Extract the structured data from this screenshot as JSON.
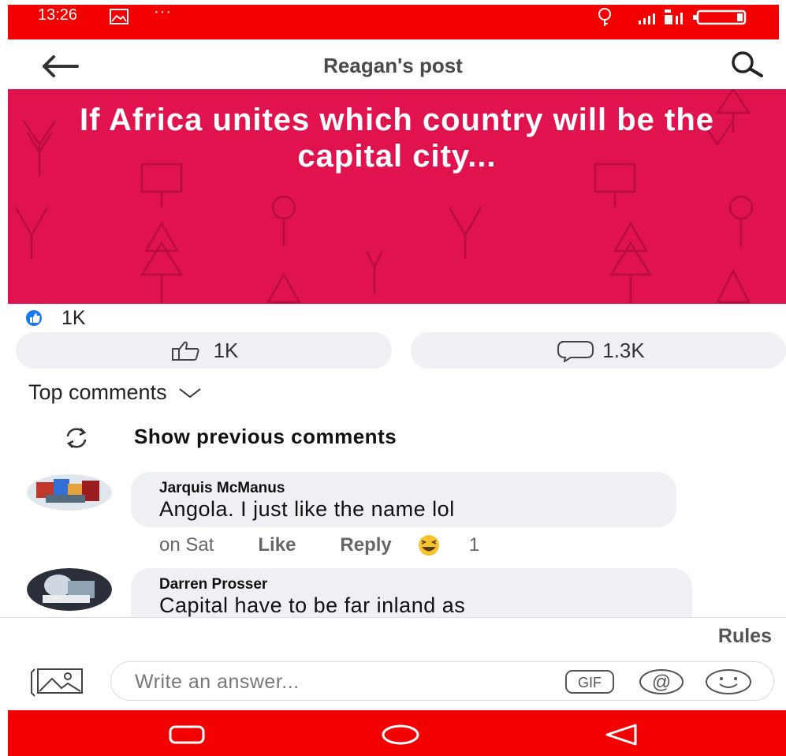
{
  "status_bar": {
    "time": "13:26",
    "dots": "···",
    "color": "#f30000"
  },
  "header": {
    "title": "Reagan's post"
  },
  "post": {
    "text": "If Africa unites which country will be the capital city...",
    "background_color": "#e0134e"
  },
  "reactions": {
    "summary_count": "1K",
    "like_count": "1K",
    "comment_count": "1.3K"
  },
  "comments_section": {
    "sort_label": "Top comments",
    "show_previous": "Show previous comments",
    "comments": [
      {
        "author": "Jarquis McManus",
        "text": "Angola. I just like the name lol",
        "time": "on Sat",
        "like_label": "Like",
        "reply_label": "Reply",
        "reaction_count": "1"
      },
      {
        "author": "Darren Prosser",
        "text": "Capital have to be far inland as"
      }
    ]
  },
  "composer": {
    "rules_label": "Rules",
    "placeholder": "Write an answer...",
    "gif_label": "GIF",
    "at_label": "@"
  },
  "accent_colors": {
    "like_blue": "#1877f2",
    "nav_red": "#f30000"
  }
}
